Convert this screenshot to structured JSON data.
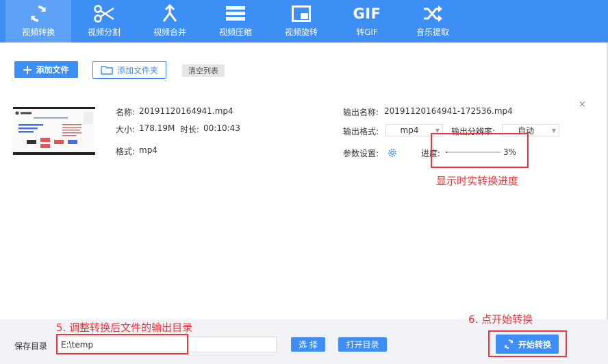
{
  "tabs": [
    {
      "label": "视频转换",
      "icon": "refresh-icon",
      "active": true
    },
    {
      "label": "视频分割",
      "icon": "scissors-icon"
    },
    {
      "label": "视频合并",
      "icon": "merge-icon"
    },
    {
      "label": "视频压缩",
      "icon": "compress-icon"
    },
    {
      "label": "视频旋转",
      "icon": "rotate-icon"
    },
    {
      "label": "转GIF",
      "icon": "gif-icon",
      "icon_text": "GIF"
    },
    {
      "label": "音乐提取",
      "icon": "shuffle-icon"
    }
  ],
  "toolbar": {
    "add_file": "添加文件",
    "add_folder": "添加文件夹",
    "clear_list": "清空列表"
  },
  "file": {
    "name_label": "名称:",
    "name": "20191120164941.mp4",
    "size_label": "大小:",
    "size": "178.19M",
    "duration_label": "时长:",
    "duration": "00:10:43",
    "format_label": "格式:",
    "format": "mp4",
    "output_name_label": "输出名称:",
    "output_name": "20191120164941-172536.mp4",
    "output_format_label": "输出格式:",
    "output_format": "mp4",
    "resolution_label": "输出分辨率:",
    "resolution": "自动",
    "params_label": "参数设置:",
    "progress_label": "进度:",
    "progress_text": "3%",
    "progress_value": 3,
    "close_symbol": "×"
  },
  "annotations": {
    "progress_note": "显示时实转换进度",
    "dir_note": "5. 调整转换后文件的输出目录",
    "start_note": "6. 点开始转换"
  },
  "bottom": {
    "save_dir_label": "保存目录",
    "save_dir": "E:\\temp",
    "select_button": "选 择",
    "open_dir_button": "打开目录",
    "start_button": "开始转换"
  },
  "colors": {
    "accent": "#3d8ef5",
    "annotation": "#e8373d"
  }
}
